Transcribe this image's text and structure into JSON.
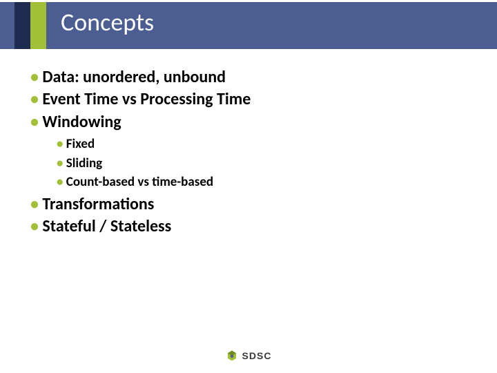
{
  "title": "Concepts",
  "bullets": {
    "b0": "Data: unordered, unbound",
    "b1": "Event Time vs Processing Time",
    "b2": "Windowing",
    "b2_sub": {
      "s0": "Fixed",
      "s1": "Sliding",
      "s2": "Count-based vs time-based"
    },
    "b3": "Transformations",
    "b4": "Stateful / Stateless"
  },
  "footer": {
    "logo_text": "SDSC"
  },
  "colors": {
    "bar": "#4c5e91",
    "navy": "#1d2c50",
    "green": "#a2c037"
  }
}
